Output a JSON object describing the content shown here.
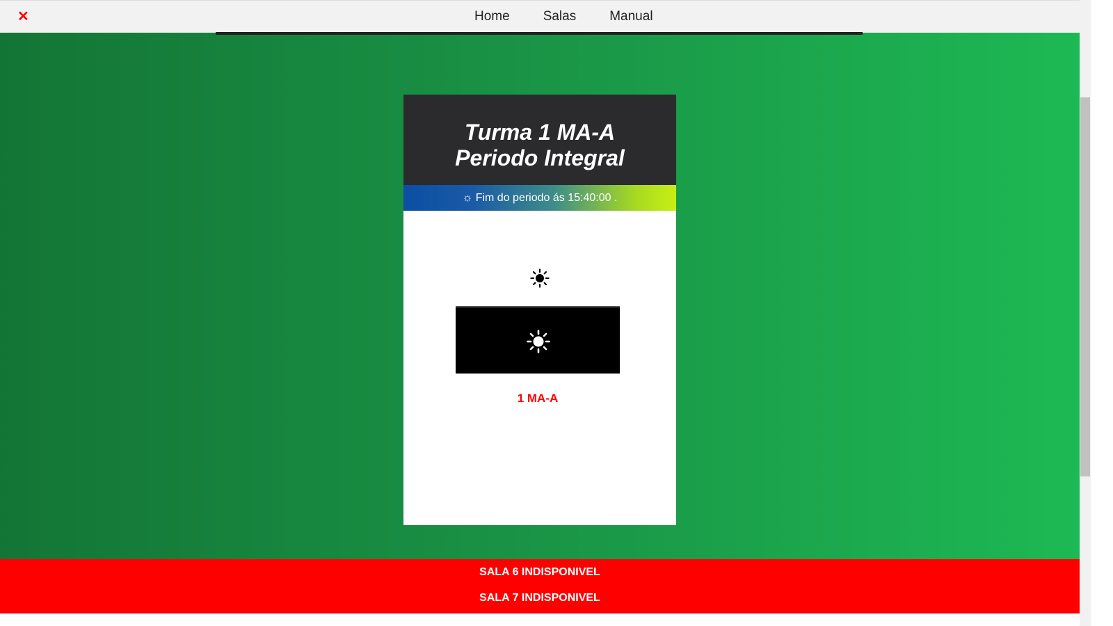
{
  "topbar": {
    "close_label": "✕",
    "nav": [
      {
        "label": "Home"
      },
      {
        "label": "Salas"
      },
      {
        "label": "Manual"
      }
    ]
  },
  "card": {
    "title_line1": "Turma 1 MA-A",
    "title_line2": "Periodo Integral",
    "period_text": "☼ Fim do periodo ás 15:40:00 .",
    "class_code": "1 MA-A"
  },
  "alerts": [
    {
      "text": "SALA 6 INDISPONIVEL"
    },
    {
      "text": "SALA 7 INDISPONIVEL"
    }
  ],
  "colors": {
    "alert_bg": "#ff0000",
    "class_code": "#ff0000",
    "header_bg": "#2b2b2e"
  },
  "icons": {
    "close": "close-icon",
    "sun_black": "sun-icon",
    "sun_white": "sun-icon"
  }
}
